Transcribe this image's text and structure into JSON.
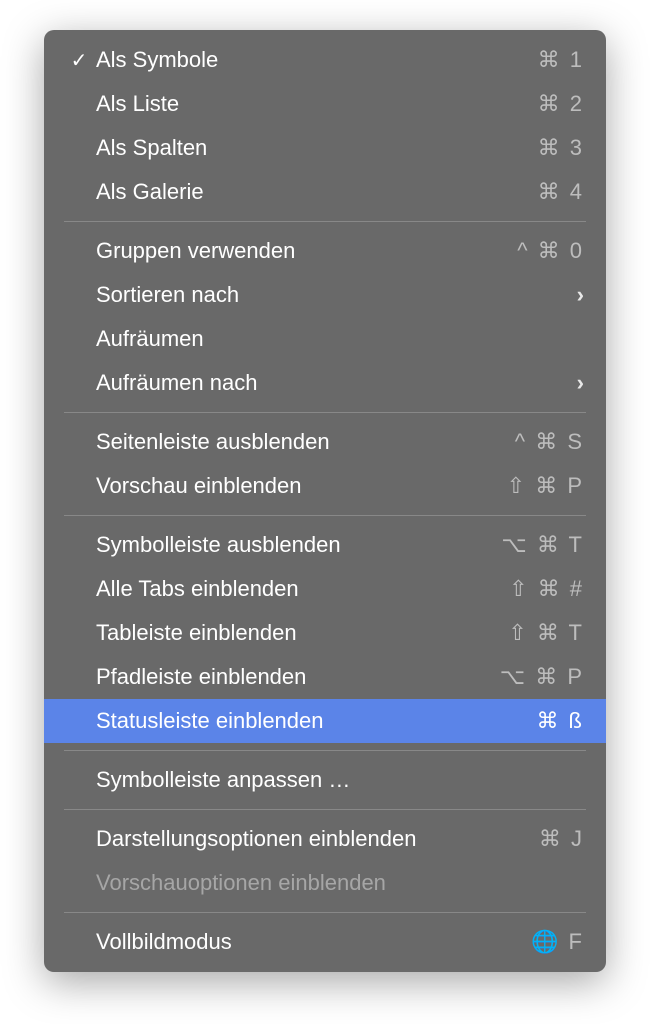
{
  "menu": {
    "sections": [
      [
        {
          "id": "view-as-icons",
          "label": "Als Symbole",
          "checked": true,
          "shortcut": "⌘ 1"
        },
        {
          "id": "view-as-list",
          "label": "Als Liste",
          "shortcut": "⌘ 2"
        },
        {
          "id": "view-as-columns",
          "label": "Als Spalten",
          "shortcut": "⌘ 3"
        },
        {
          "id": "view-as-gallery",
          "label": "Als Galerie",
          "shortcut": "⌘ 4"
        }
      ],
      [
        {
          "id": "use-groups",
          "label": "Gruppen verwenden",
          "shortcut": "^ ⌘ 0"
        },
        {
          "id": "sort-by",
          "label": "Sortieren nach",
          "submenu": true
        },
        {
          "id": "clean-up",
          "label": "Aufräumen"
        },
        {
          "id": "clean-up-by",
          "label": "Aufräumen nach",
          "submenu": true
        }
      ],
      [
        {
          "id": "hide-sidebar",
          "label": "Seitenleiste ausblenden",
          "shortcut": "^ ⌘ S"
        },
        {
          "id": "show-preview",
          "label": "Vorschau einblenden",
          "shortcut": "⇧ ⌘ P"
        }
      ],
      [
        {
          "id": "hide-toolbar",
          "label": "Symbolleiste ausblenden",
          "shortcut": "⌥ ⌘ T"
        },
        {
          "id": "show-all-tabs",
          "label": "Alle Tabs einblenden",
          "shortcut": "⇧ ⌘ #"
        },
        {
          "id": "show-tab-bar",
          "label": "Tableiste einblenden",
          "shortcut": "⇧ ⌘ T"
        },
        {
          "id": "show-path-bar",
          "label": "Pfadleiste einblenden",
          "shortcut": "⌥ ⌘ P"
        },
        {
          "id": "show-status-bar",
          "label": "Statusleiste einblenden",
          "shortcut": "⌘ ß",
          "highlighted": true
        }
      ],
      [
        {
          "id": "customize-toolbar",
          "label": "Symbolleiste anpassen …"
        }
      ],
      [
        {
          "id": "show-view-options",
          "label": "Darstellungsoptionen einblenden",
          "shortcut": "⌘ J"
        },
        {
          "id": "show-preview-options",
          "label": "Vorschauoptionen einblenden",
          "disabled": true
        }
      ],
      [
        {
          "id": "enter-full-screen",
          "label": "Vollbildmodus",
          "shortcut": "🌐 F"
        }
      ]
    ]
  }
}
